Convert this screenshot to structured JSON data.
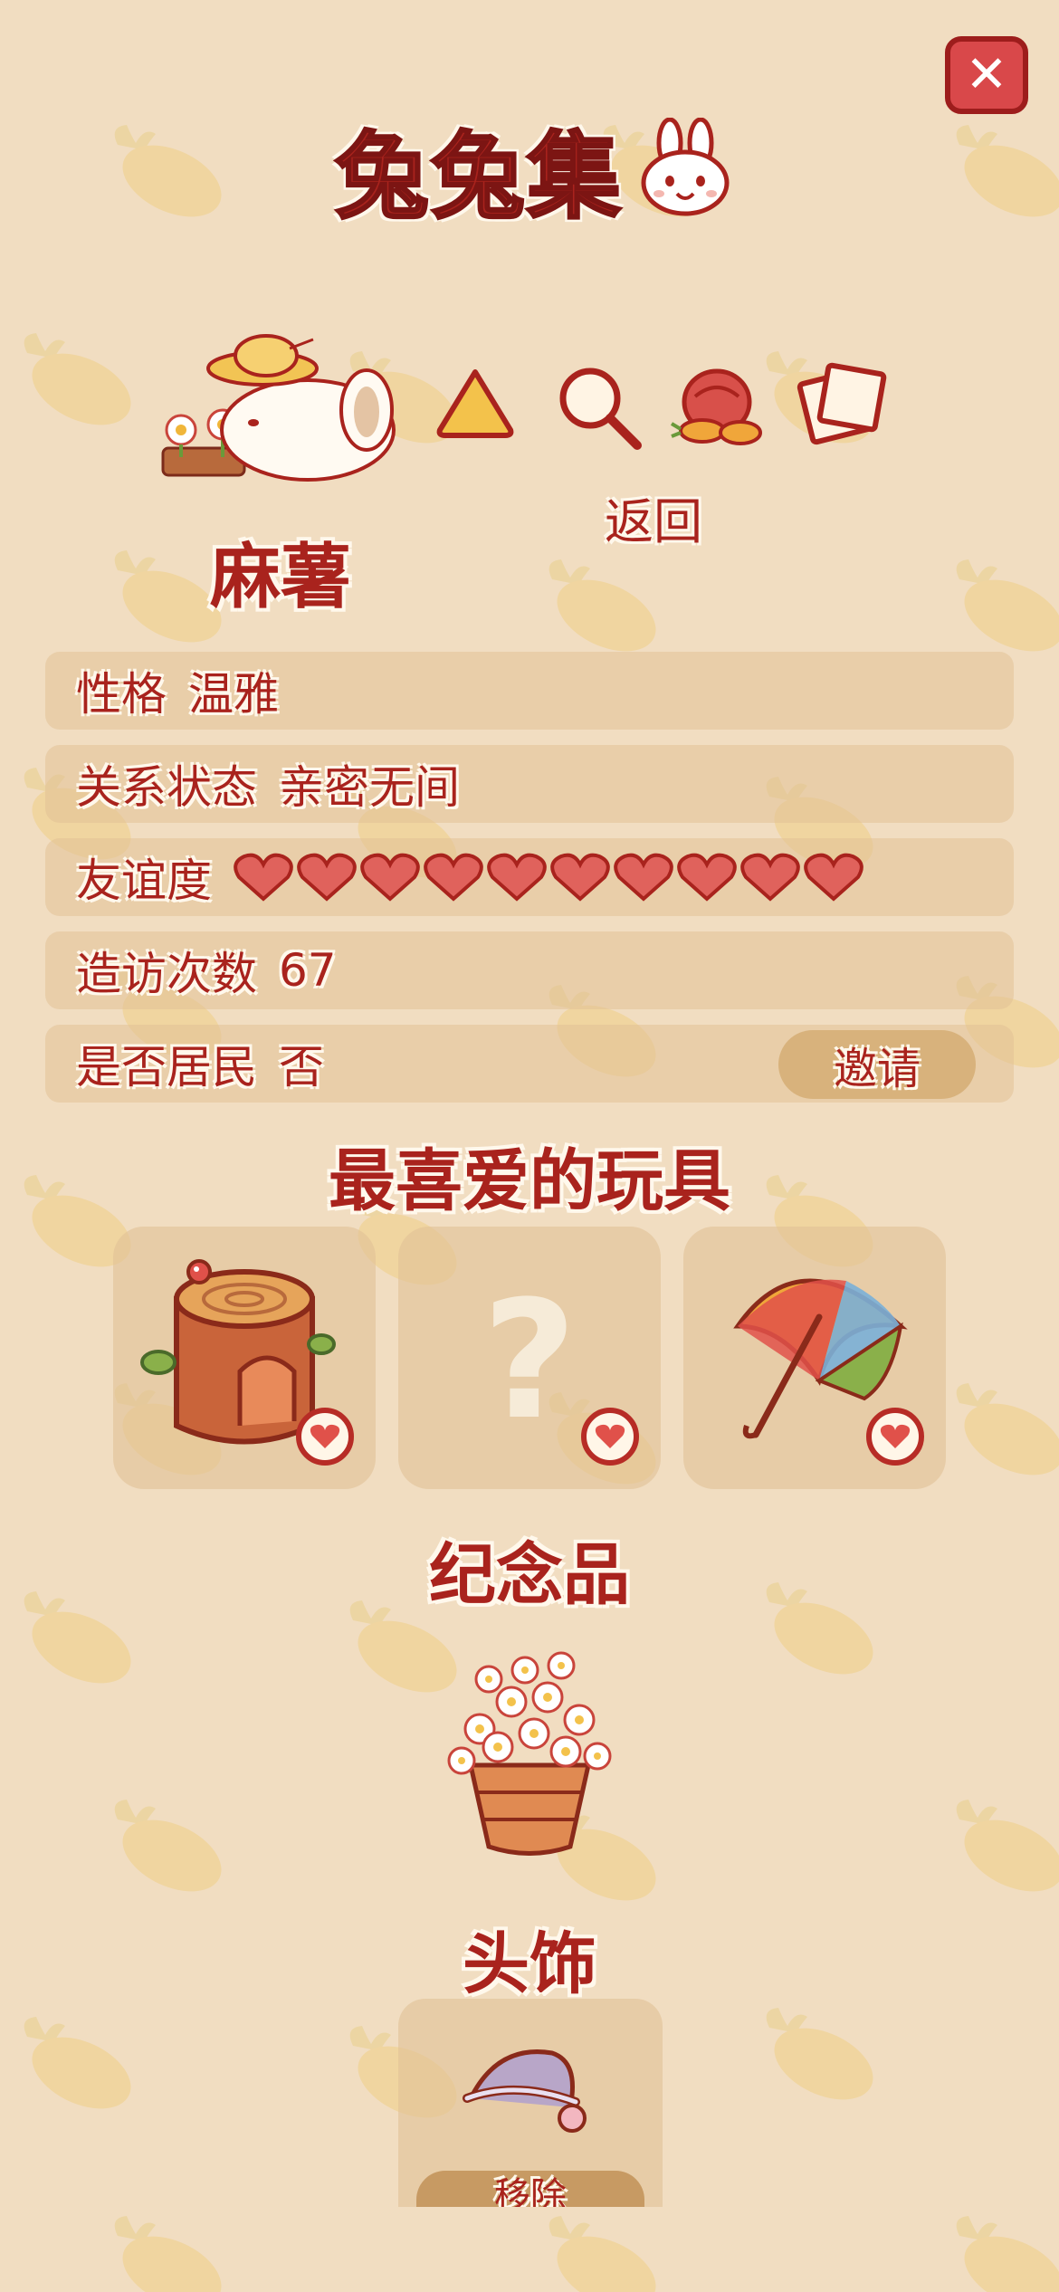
{
  "header": {
    "title": "兔兔集",
    "close_icon": "close-icon"
  },
  "toolbar": {
    "icons": [
      "rice-ball-icon",
      "magnifier-icon",
      "food-basket-icon",
      "photo-icon"
    ],
    "back_label": "返回"
  },
  "bunny": {
    "name": "麻薯",
    "info": {
      "personality_label": "性格",
      "personality_value": "温雅",
      "relationship_label": "关系状态",
      "relationship_value": "亲密无间",
      "friendship_label": "友谊度",
      "friendship_hearts": 10,
      "friendship_max": 10,
      "visits_label": "造访次数",
      "visits_value": "67",
      "resident_label": "是否居民",
      "resident_value": "否",
      "invite_label": "邀请"
    }
  },
  "favorite_toys": {
    "title": "最喜爱的玩具",
    "items": [
      {
        "icon": "tree-stump-house-icon",
        "known": true
      },
      {
        "icon": "question-mark-icon",
        "known": false
      },
      {
        "icon": "rainbow-umbrella-icon",
        "known": true
      }
    ]
  },
  "memento": {
    "title": "纪念品",
    "icon": "flower-basket-icon"
  },
  "headwear": {
    "title": "头饰",
    "icon": "nightcap-icon",
    "remove_label": "移除"
  },
  "colors": {
    "background": "#f1ddc1",
    "text_red": "#a9231d",
    "row_bg": "#e1c196",
    "heart": "#e0625c"
  }
}
